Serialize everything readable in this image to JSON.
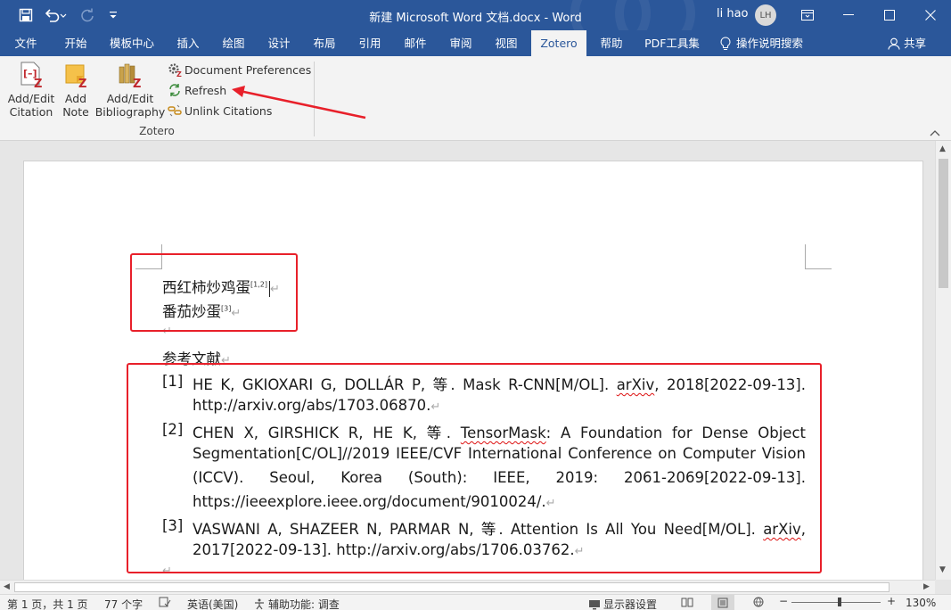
{
  "titlebar": {
    "title": "新建 Microsoft Word 文档.docx  -  Word",
    "user": "li hao",
    "avatar_initials": "LH",
    "quick_access_icons": [
      "save-icon",
      "undo-icon",
      "redo-icon",
      "customize-icon"
    ],
    "window_controls": [
      "ribbon-display-icon",
      "minimize-icon",
      "maximize-icon",
      "close-icon"
    ]
  },
  "tabs": [
    "文件",
    "开始",
    "模板中心",
    "插入",
    "绘图",
    "设计",
    "布局",
    "引用",
    "邮件",
    "审阅",
    "视图",
    "Zotero",
    "帮助",
    "PDF工具集",
    "操作说明搜索",
    "共享"
  ],
  "active_tab": "Zotero",
  "ribbon": {
    "group_label": "Zotero",
    "big_buttons": [
      {
        "line1": "Add/Edit",
        "line2": "Citation"
      },
      {
        "line1": "Add",
        "line2": "Note"
      },
      {
        "line1": "Add/Edit",
        "line2": "Bibliography"
      }
    ],
    "small_buttons": [
      "Document Preferences",
      "Refresh",
      "Unlink Citations"
    ]
  },
  "document": {
    "lines": [
      {
        "text": "西红柿炒鸡蛋",
        "cite": "[1,2]"
      },
      {
        "text": "番茄炒蛋",
        "cite": "[3]"
      }
    ],
    "heading": "参考文献",
    "return_mark": "↵",
    "references": [
      {
        "num": "[1]",
        "lines": [
          "HE K, GKIOXARI G, DOLLÁR P, 等. Mask R-CNN[M/OL]. arXiv, 2018[2022-09-13].",
          "http://arxiv.org/abs/1703.06870."
        ]
      },
      {
        "num": "[2]",
        "lines": [
          "CHEN X, GIRSHICK R, HE K, 等. TensorMask: A Foundation for Dense Object",
          "Segmentation[C/OL]//2019 IEEE/CVF International Conference on Computer Vision",
          "(ICCV). Seoul, Korea (South): IEEE, 2019: 2061-2069[2022-09-13].",
          "https://ieeexplore.ieee.org/document/9010024/."
        ]
      },
      {
        "num": "[3]",
        "lines": [
          "VASWANI A, SHAZEER N, PARMAR N, 等. Attention Is All You Need[M/OL]. arXiv,",
          "2017[2022-09-13]. http://arxiv.org/abs/1706.03762."
        ]
      }
    ]
  },
  "statusbar": {
    "page": "第 1 页，共 1 页",
    "words": "77 个字",
    "language": "英语(美国)",
    "accessibility": "辅助功能: 调查",
    "display_settings": "显示器设置",
    "zoom": "130%"
  },
  "colors": {
    "accent": "#2b579a",
    "annotation_red": "#e8202a"
  }
}
